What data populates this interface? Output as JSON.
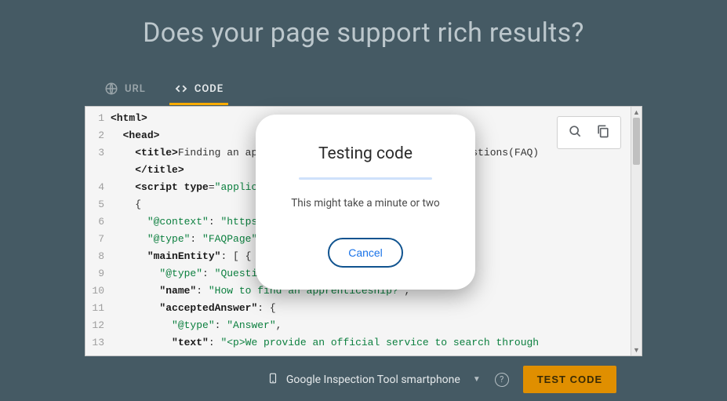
{
  "header": {
    "title": "Does your page support rich results?"
  },
  "tabs": {
    "url": {
      "label": "URL"
    },
    "code": {
      "label": "CODE"
    }
  },
  "editor": {
    "actions": {
      "search": "search-icon",
      "copy": "copy-icon"
    },
    "lines": [
      {
        "n": "1",
        "t": "<html>"
      },
      {
        "n": "2",
        "t": "  <head>"
      },
      {
        "n": "3",
        "t": "    <title>Finding an apprenticeship - Frequently Asked Questions(FAQ)</title>"
      },
      {
        "n": "",
        "t": "    </title>"
      },
      {
        "n": "4",
        "t": "    <script type=\"application/ld+json\">"
      },
      {
        "n": "5",
        "t": "    {"
      },
      {
        "n": "6",
        "t": "      \"@context\": \"https://schema.org\","
      },
      {
        "n": "7",
        "t": "      \"@type\": \"FAQPage\","
      },
      {
        "n": "8",
        "t": "      \"mainEntity\": [ {"
      },
      {
        "n": "9",
        "t": "        \"@type\": \"Question\","
      },
      {
        "n": "10",
        "t": "        \"name\": \"How to find an apprenticeship?\","
      },
      {
        "n": "11",
        "t": "        \"acceptedAnswer\": {"
      },
      {
        "n": "12",
        "t": "          \"@type\": \"Answer\","
      },
      {
        "n": "13",
        "t": "          \"text\": \"<p>We provide an official service to search through available apprenticeships. To get started, create an account here, specify"
      }
    ]
  },
  "footer": {
    "device": "Google Inspection Tool smartphone",
    "test_button": "TEST CODE"
  },
  "modal": {
    "title": "Testing code",
    "message": "This might take a minute or two",
    "cancel": "Cancel"
  }
}
